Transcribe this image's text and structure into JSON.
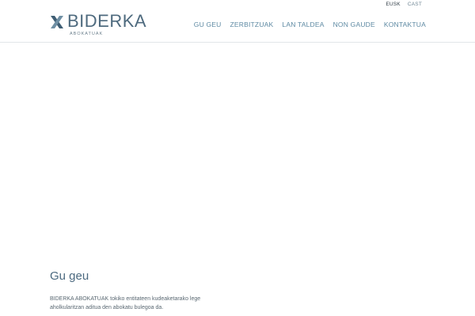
{
  "logo": {
    "name": "BIDERKA",
    "tagline": "ABOKATUAK",
    "icon": "x-logo-icon"
  },
  "languages": [
    {
      "label": "EUSK",
      "active": true
    },
    {
      "label": "CAST",
      "active": false
    }
  ],
  "nav": {
    "items": [
      {
        "label": "GU GEU"
      },
      {
        "label": "ZERBITZUAK"
      },
      {
        "label": "LAN TALDEA"
      },
      {
        "label": "NON GAUDE"
      },
      {
        "label": "KONTAKTUA"
      }
    ]
  },
  "section": {
    "title": "Gu geu",
    "body": "BIDERKA ABOKATUAK tokiko entitateen kudeaketarako lege aholkularitzan aditua den abokatu bulegoa da."
  },
  "colors": {
    "brand": "#4e6a7e",
    "nav": "#5e8aa3",
    "accent_dark": "#2f3b44"
  }
}
